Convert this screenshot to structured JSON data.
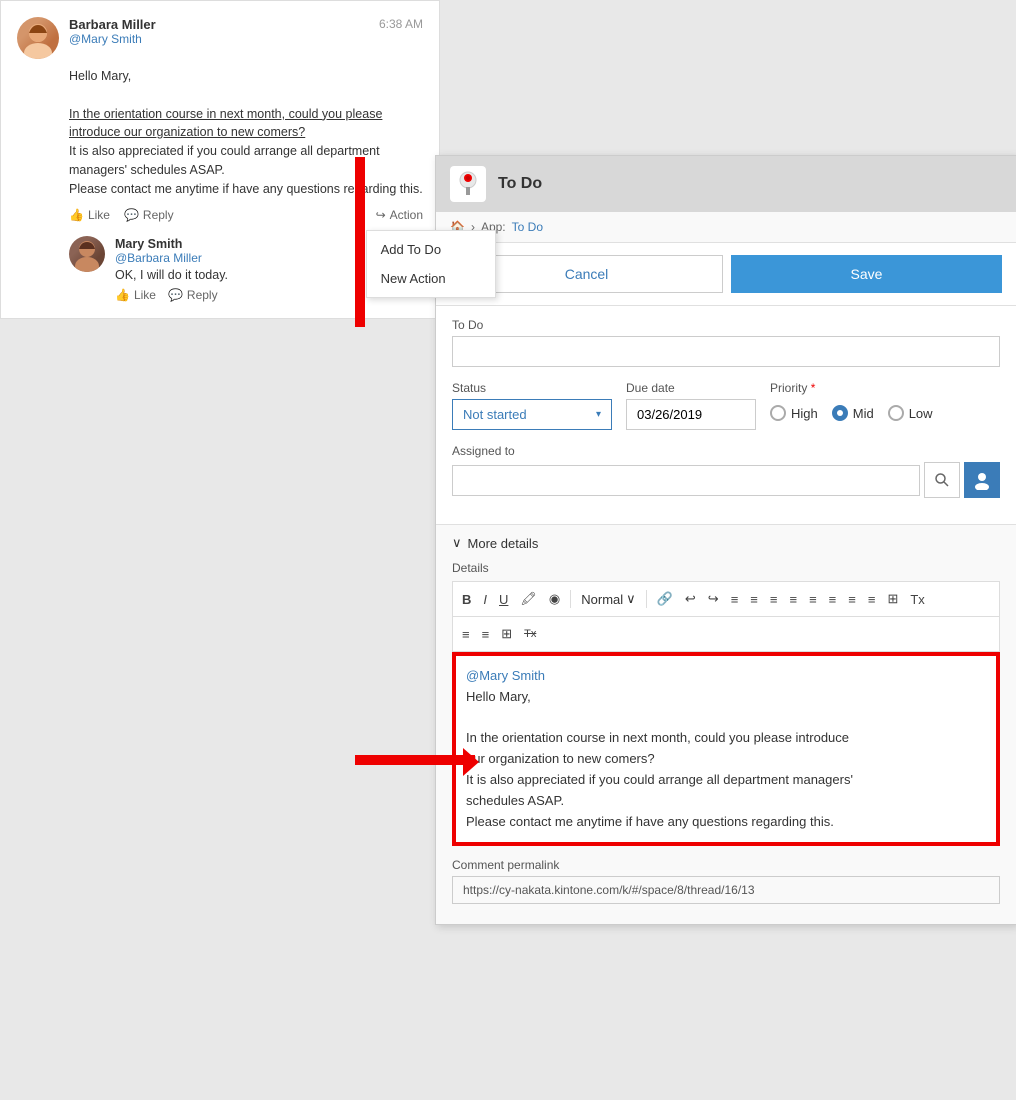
{
  "feed": {
    "post": {
      "author": "Barbara Miller",
      "mention": "@Mary Smith",
      "time": "6:38 AM",
      "greeting": "Hello Mary,",
      "body_line1": "In the orientation course in next month, could you please introduce our organization to new comers?",
      "body_line2": "It is also appreciated if you could arrange all department managers' schedules ASAP.",
      "body_line3": "Please contact me anytime if have any questions regarding this.",
      "action_like": "Like",
      "action_reply": "Reply",
      "action_action": "Action"
    },
    "dropdown": {
      "item1": "Add To Do",
      "item2": "New Action"
    },
    "comment": {
      "author": "Mary Smith",
      "mention": "@Barbara Miller",
      "text": "OK, I will do it today.",
      "action_like": "Like",
      "action_reply": "Reply"
    }
  },
  "todo": {
    "header_title": "To Do",
    "breadcrumb_home": "🏠",
    "breadcrumb_sep": "›",
    "breadcrumb_app": "App:",
    "breadcrumb_link": "To Do",
    "btn_cancel": "Cancel",
    "btn_save": "Save",
    "field_todo_label": "To Do",
    "field_status_label": "Status",
    "field_status_value": "Not started",
    "field_duedate_label": "Due date",
    "field_duedate_value": "03/26/2019",
    "field_priority_label": "Priority",
    "field_priority_required": "*",
    "priority_high": "High",
    "priority_mid": "Mid",
    "priority_low": "Low",
    "field_assigned_label": "Assigned to",
    "more_details_label": "More details",
    "details_label": "Details",
    "toolbar_bold": "B",
    "toolbar_italic": "I",
    "toolbar_underline": "U",
    "toolbar_highlight": "🖍",
    "toolbar_eraser": "◉",
    "toolbar_format": "Normal",
    "format_chevron": "∨",
    "toolbar_link": "🔗",
    "toolbar_undo": "↩",
    "toolbar_redo": "↪",
    "toolbar_list1": "≡",
    "toolbar_list2": "≡",
    "toolbar_align1": "≡",
    "toolbar_align2": "≡",
    "toolbar_align3": "≡",
    "toolbar_align4": "≡",
    "toolbar_align5": "≡",
    "toolbar_align6": "≡",
    "toolbar_clear": "Tx",
    "editor_mention": "@Mary Smith",
    "editor_greeting": "Hello Mary,",
    "editor_body1": "In the orientation course in next month, could you please introduce",
    "editor_body2": "our organization to new comers?",
    "editor_body3": "It is also appreciated if you could arrange all department managers'",
    "editor_body4": "schedules ASAP.",
    "editor_body5": "Please contact me anytime if have any questions regarding this.",
    "permalink_label": "Comment permalink",
    "permalink_value": "https://cy-nakata.kintone.com/k/#/space/8/thread/16/13"
  }
}
